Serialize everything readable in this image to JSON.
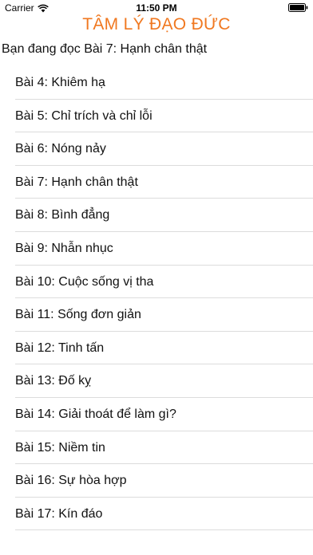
{
  "status_bar": {
    "carrier": "Carrier",
    "time": "11:50 PM",
    "wifi_icon": "wifi-icon",
    "battery_icon": "battery-icon"
  },
  "header": {
    "title": "TÂM LÝ ĐẠO ĐỨC",
    "title_color": "#f07820"
  },
  "reading": {
    "text": "Bạn đang đọc Bài 7: Hạnh chân thật"
  },
  "lessons": [
    {
      "label": "Bài 4: Khiêm hạ"
    },
    {
      "label": "Bài 5: Chỉ trích và chỉ lỗi"
    },
    {
      "label": "Bài 6: Nóng nảy"
    },
    {
      "label": "Bài 7: Hạnh chân thật"
    },
    {
      "label": "Bài 8: Bình đẳng"
    },
    {
      "label": "Bài 9: Nhẫn nhục"
    },
    {
      "label": "Bài 10: Cuộc sống vị tha"
    },
    {
      "label": "Bài 11: Sống đơn giản"
    },
    {
      "label": "Bài 12: Tinh tấn"
    },
    {
      "label": "Bài 13: Đố kỵ"
    },
    {
      "label": "Bài 14: Giải thoát để làm gì?"
    },
    {
      "label": "Bài 15: Niềm tin"
    },
    {
      "label": "Bài 16: Sự hòa hợp"
    },
    {
      "label": "Bài 17: Kín đáo"
    }
  ]
}
